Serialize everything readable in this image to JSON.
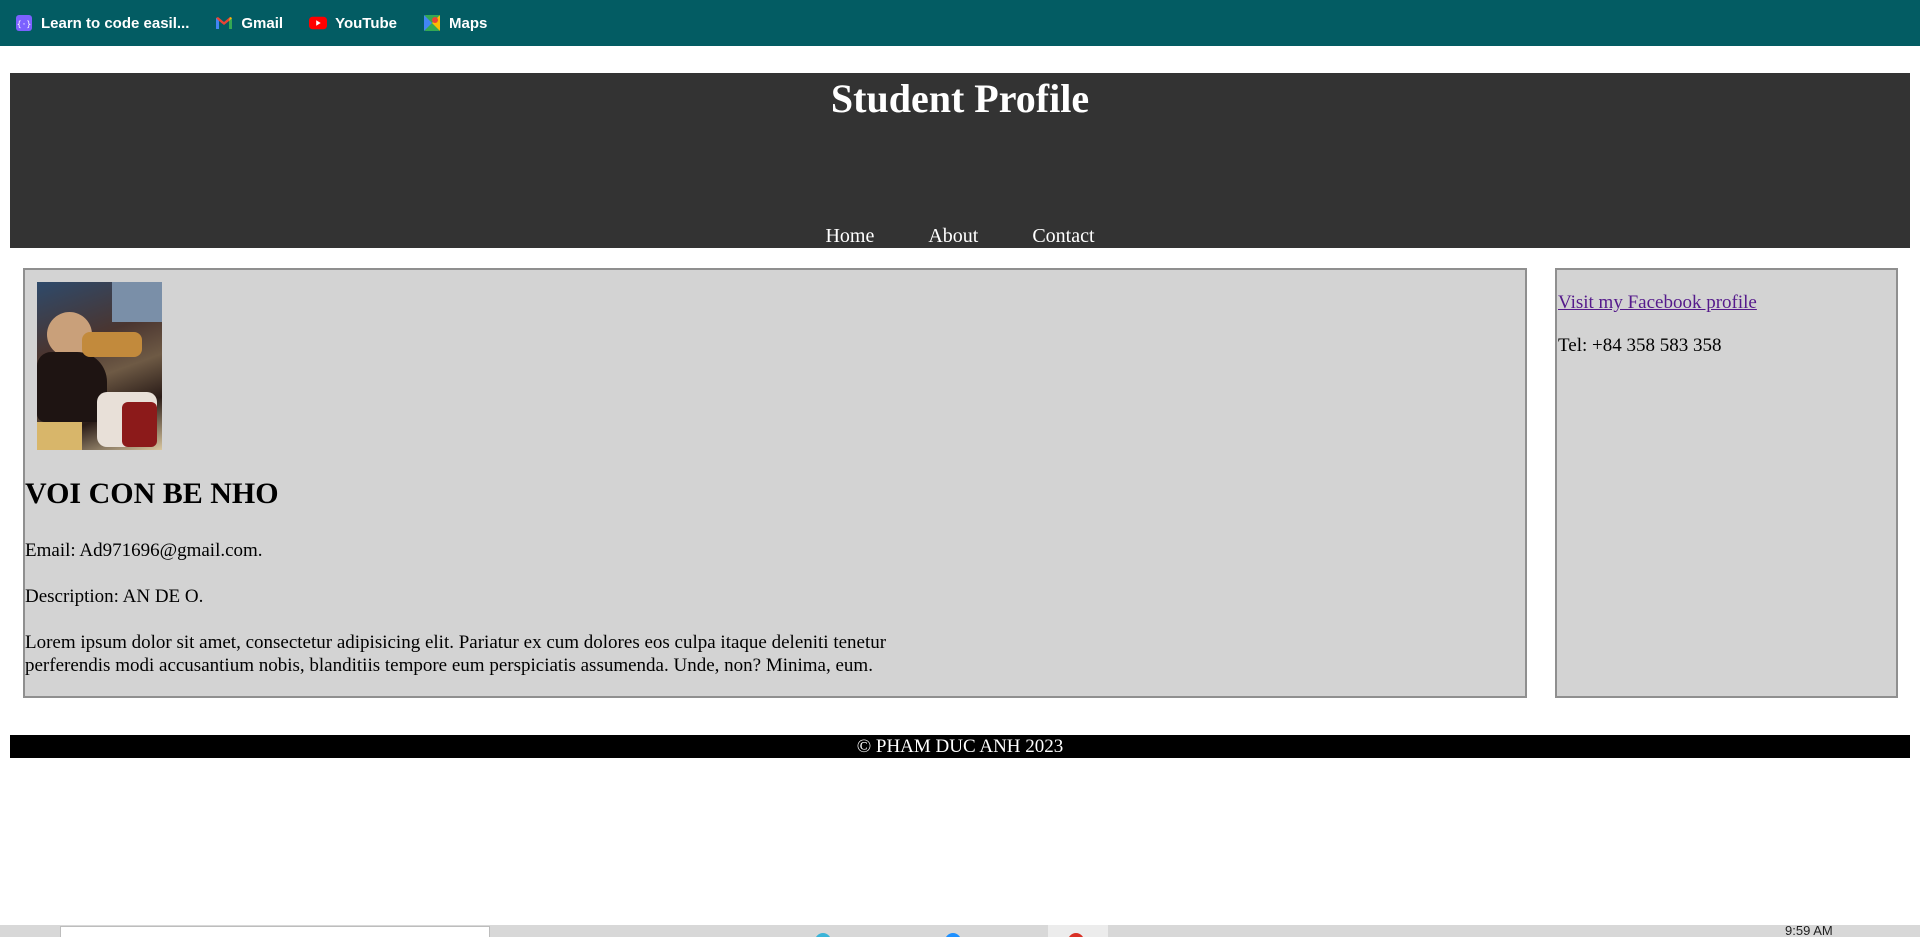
{
  "bookmarks": [
    {
      "label": "Learn to code easil...",
      "icon": "code-icon",
      "color": "#7b61ff"
    },
    {
      "label": "Gmail",
      "icon": "gmail-icon",
      "color": "#ea4335"
    },
    {
      "label": "YouTube",
      "icon": "youtube-icon",
      "color": "#ff0000"
    },
    {
      "label": "Maps",
      "icon": "maps-icon",
      "color": "#34a853"
    }
  ],
  "header": {
    "title": "Student Profile",
    "nav": [
      "Home",
      "About",
      "Contact"
    ]
  },
  "main": {
    "photo_icon": "profile-photo",
    "name": "VOI CON BE NHO",
    "email": "Email: Ad971696@gmail.com.",
    "description": "Description: AN DE O.",
    "lorem": "Lorem ipsum dolor sit amet, consectetur adipisicing elit. Pariatur ex cum dolores eos culpa itaque deleniti tenetur perferendis modi accusantium nobis, blanditiis tempore eum perspiciatis assumenda. Unde, non? Minima, eum."
  },
  "sidebar": {
    "facebook_link": "Visit my Facebook profile",
    "tel": "Tel: +84 358 583 358"
  },
  "footer": {
    "text": "© PHAM DUC ANH 2023"
  },
  "taskbar": {
    "clock": "9:59 AM"
  },
  "colors": {
    "bookmarks_bar": "#035c63",
    "header_bg": "#333333",
    "card_bg": "#d3d3d3",
    "footer_bg": "#000000",
    "visited_link": "#551a8b"
  }
}
